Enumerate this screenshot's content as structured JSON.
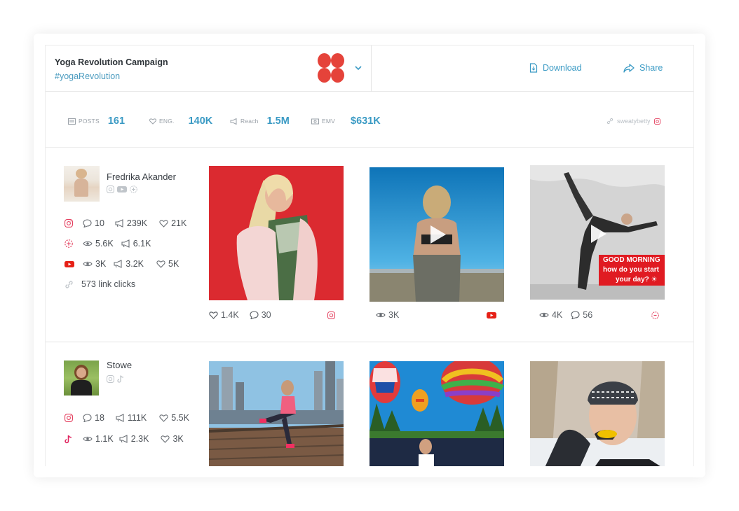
{
  "campaign": {
    "title": "Yoga Revolution Campaign",
    "hashtag": "#yogaRevolution",
    "logo_color": "#e5433a"
  },
  "actions": {
    "download": "Download",
    "share": "Share"
  },
  "stats": [
    {
      "icon": "posts-icon",
      "label": "POSTS",
      "value": "161"
    },
    {
      "icon": "heart-icon",
      "label": "ENG.",
      "value": "140K"
    },
    {
      "icon": "megaphone-icon",
      "label": "Reach",
      "value": "1.5M"
    },
    {
      "icon": "money-icon",
      "label": "EMV",
      "value": "$631K"
    }
  ],
  "brand_handle": "sweatybetty",
  "creators": [
    {
      "name": "Fredrika Akander",
      "metrics": {
        "instagram": {
          "comments": "10",
          "reach": "239K",
          "likes": "21K"
        },
        "stories": {
          "views": "5.6K",
          "reach": "6.1K"
        },
        "youtube": {
          "views": "3K",
          "reach": "3.2K",
          "likes": "5K"
        },
        "link_clicks": "573 link clicks"
      },
      "posts": [
        {
          "platform": "instagram",
          "likes": "1.4K",
          "comments": "30"
        },
        {
          "platform": "youtube",
          "views": "3K"
        },
        {
          "platform": "stories",
          "views": "4K",
          "comments": "56",
          "overlay_text": [
            "GOOD MORNING",
            "how do you start ",
            "your day? ☀"
          ]
        }
      ]
    },
    {
      "name": "Stowe",
      "metrics": {
        "instagram": {
          "comments": "18",
          "reach": "111K",
          "likes": "5.5K"
        },
        "tiktok": {
          "views": "1.1K",
          "reach": "2.3K",
          "likes": "3K"
        }
      }
    }
  ],
  "colors": {
    "accent": "#3a9ac4",
    "instagram": "#e4405f",
    "youtube": "#e62117"
  }
}
